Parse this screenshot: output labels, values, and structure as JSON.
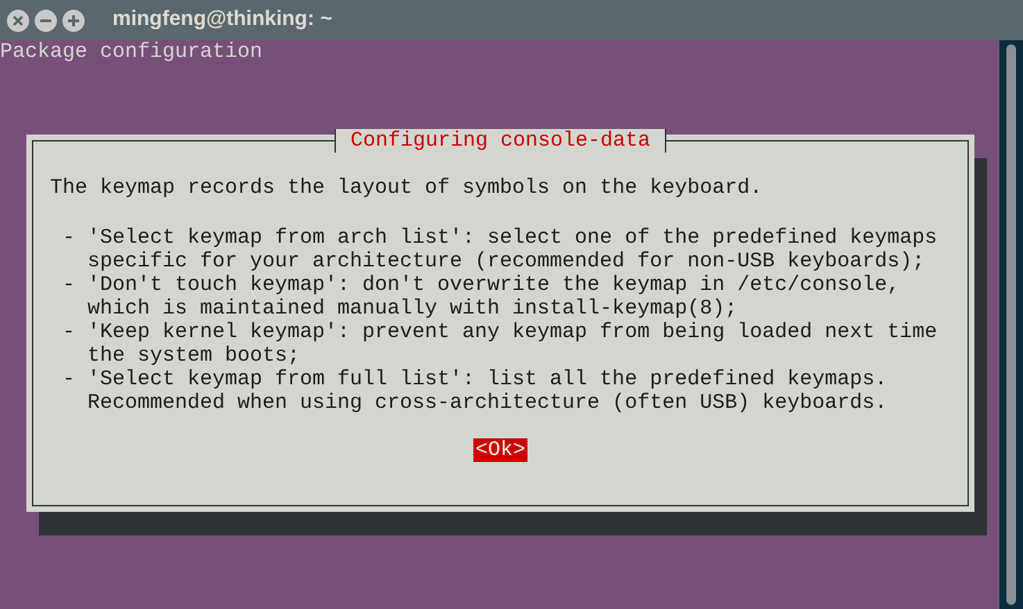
{
  "window": {
    "title": "mingfeng@thinking: ~"
  },
  "terminal": {
    "header": "Package configuration",
    "dialog": {
      "title": "Configuring console-data",
      "intro": "The keymap records the layout of symbols on the keyboard.",
      "items": [
        {
          "marker": "-",
          "lines": [
            "'Select keymap from arch list': select one of the predefined keymaps",
            "specific for your architecture (recommended for non-USB keyboards);"
          ]
        },
        {
          "marker": "-",
          "lines": [
            "'Don't touch keymap': don't overwrite the keymap in /etc/console,",
            "which is maintained manually with install-keymap(8);"
          ]
        },
        {
          "marker": "-",
          "lines": [
            "'Keep kernel keymap': prevent any keymap from being loaded next time",
            "the system boots;"
          ]
        },
        {
          "marker": "-",
          "lines": [
            "'Select keymap from full list': list all the predefined keymaps.",
            "Recommended when using cross-architecture (often USB) keyboards."
          ]
        }
      ],
      "button": {
        "label": "<Ok>",
        "selected": true
      }
    }
  }
}
